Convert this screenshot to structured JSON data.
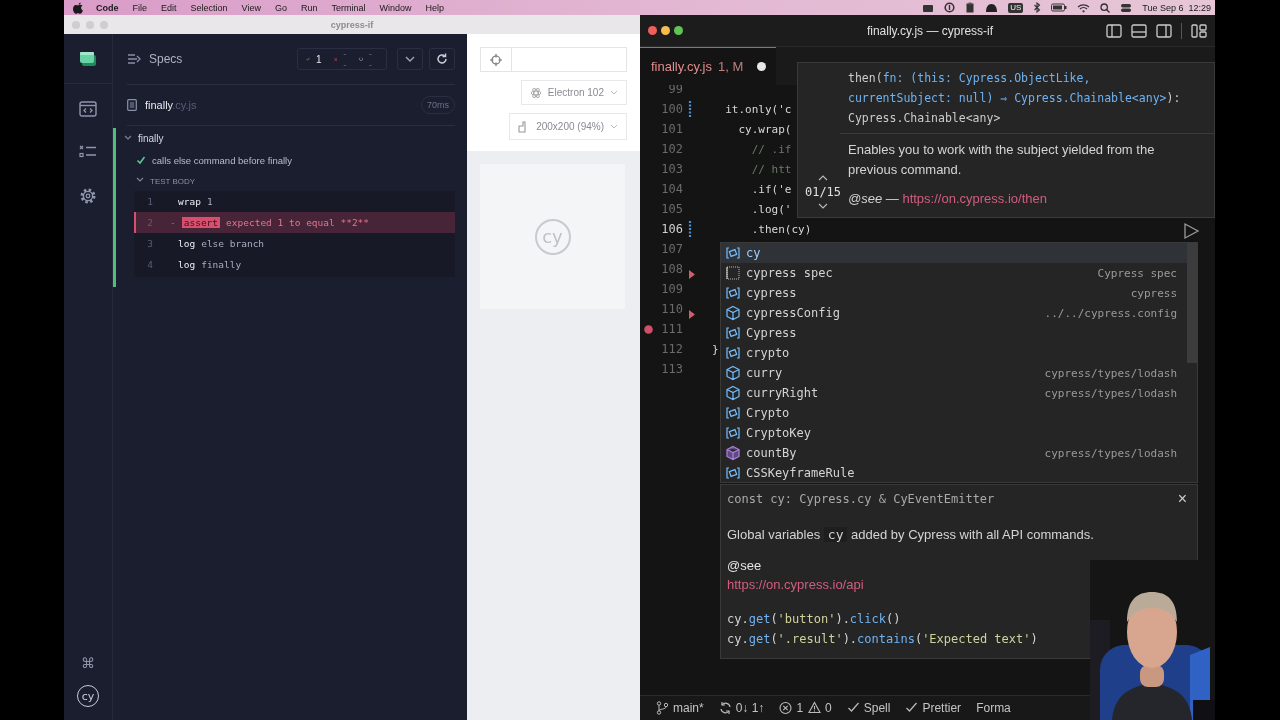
{
  "menu_bar": {
    "app": "Code",
    "items": [
      "File",
      "Edit",
      "Selection",
      "View",
      "Go",
      "Run",
      "Terminal",
      "Window",
      "Help"
    ],
    "input_source": "US",
    "clock": "Tue Sep 6  12:29"
  },
  "cypress_window": {
    "title": "cypress-if",
    "shortcut_icon": "⌘",
    "logo": "cy",
    "reporter": {
      "title": "Specs",
      "passed": "1",
      "failed": "--",
      "pending": "--",
      "spec": {
        "name": "finally",
        "extension": ".cy.js",
        "duration": "70ms"
      },
      "suite": {
        "title": "finally",
        "expanded": true,
        "test": {
          "title": "calls else command before finally",
          "passed": true,
          "section": "TEST BODY",
          "section_expanded": true,
          "commands": [
            {
              "number": "1",
              "name": "wrap",
              "message": "1",
              "failed": false
            },
            {
              "number": "2",
              "prefix": "-",
              "name": "assert",
              "message": "expected 1 to equal **2**",
              "failed": true
            },
            {
              "number": "3",
              "name": "log",
              "message": "else branch",
              "failed": false
            },
            {
              "number": "4",
              "name": "log",
              "message": "finally",
              "failed": false
            }
          ]
        }
      }
    },
    "preview": {
      "browser": "Electron 102",
      "viewport": "200x200 (94%)",
      "logo": "cy"
    }
  },
  "editor_window": {
    "title": "finally.cy.js — cypress-if",
    "tabs": [
      {
        "label": "finally.cy.js",
        "badge": "1, M",
        "modified": true,
        "selected": true
      }
    ],
    "lines": [
      {
        "number": "99",
        "current": false
      },
      {
        "number": "100",
        "text": "  it.only('c",
        "kind": "code",
        "current": false,
        "git_change": true
      },
      {
        "number": "101",
        "text": "    cy.wrap(",
        "kind": "code",
        "current": false
      },
      {
        "number": "102",
        "text": "      // .if",
        "kind": "comment",
        "current": false
      },
      {
        "number": "103",
        "text": "      // htt",
        "kind": "comment",
        "current": false
      },
      {
        "number": "104",
        "text": "      .if('e",
        "kind": "code",
        "current": false
      },
      {
        "number": "105",
        "text": "      .log('",
        "kind": "code",
        "current": false
      },
      {
        "number": "106",
        "text": "      .then(cy)",
        "kind": "code",
        "current": true,
        "git_change": true
      },
      {
        "number": "107",
        "current": false
      },
      {
        "number": "108",
        "current": false,
        "folded": true
      },
      {
        "number": "109",
        "current": false
      },
      {
        "number": "110",
        "current": false,
        "folded": true
      },
      {
        "number": "111",
        "current": false,
        "breakpoint": true
      },
      {
        "number": "112",
        "text": "}",
        "kind": "code",
        "current": false
      },
      {
        "number": "113",
        "current": false
      }
    ],
    "signature_help": {
      "counter": "01/15",
      "signature": [
        {
          "text": "then(",
          "kind": "plain"
        },
        {
          "text": "fn: (this: Cypress.ObjectLike, currentSubject: null) ⇒ Cypress.Chainable<any>",
          "kind": "param"
        },
        {
          "text": "):",
          "kind": "plain"
        }
      ],
      "return_type": "Cypress.Chainable<any>",
      "description": "Enables you to work with the subject yielded from the previous command.",
      "see": "@see",
      "see_separator": "—",
      "link": "https://on.cypress.io/then"
    },
    "suggestions": [
      {
        "label": "cy",
        "kind": "variable",
        "selected": true
      },
      {
        "label": "cypress spec",
        "kind": "snippet",
        "detail": "Cypress spec",
        "selected": false
      },
      {
        "label": "cypress",
        "kind": "variable",
        "detail": "cypress",
        "selected": false
      },
      {
        "label": "cypressConfig",
        "kind": "module",
        "detail": "../../cypress.config",
        "selected": false
      },
      {
        "label": "Cypress",
        "kind": "variable",
        "selected": false
      },
      {
        "label": "crypto",
        "kind": "variable",
        "selected": false
      },
      {
        "label": "curry",
        "kind": "module",
        "detail": "cypress/types/lodash",
        "selected": false
      },
      {
        "label": "curryRight",
        "kind": "module",
        "detail": "cypress/types/lodash",
        "selected": false
      },
      {
        "label": "Crypto",
        "kind": "variable",
        "selected": false
      },
      {
        "label": "CryptoKey",
        "kind": "variable",
        "selected": false
      },
      {
        "label": "countBy",
        "kind": "method",
        "detail": "cypress/types/lodash",
        "selected": false
      },
      {
        "label": "CSSKeyframeRule",
        "kind": "variable",
        "selected": false
      }
    ],
    "details": {
      "signature": "const cy: Cypress.cy & CyEventEmitter",
      "close": "×",
      "description": [
        {
          "text": "Global variables ",
          "kind": "plain"
        },
        {
          "text": "cy",
          "kind": "code"
        },
        {
          "text": " added by Cypress with all API commands.",
          "kind": "plain"
        }
      ],
      "see": "@see",
      "link": "https://on.cypress.io/api",
      "examples": [
        [
          {
            "text": "cy",
            "kind": "ident"
          },
          {
            "text": ".",
            "kind": "punct"
          },
          {
            "text": "get",
            "kind": "method"
          },
          {
            "text": "(",
            "kind": "punct"
          },
          {
            "text": "'button'",
            "kind": "string"
          },
          {
            "text": ").",
            "kind": "punct"
          },
          {
            "text": "click",
            "kind": "method"
          },
          {
            "text": "()",
            "kind": "punct"
          }
        ],
        [
          {
            "text": "cy",
            "kind": "ident"
          },
          {
            "text": ".",
            "kind": "punct"
          },
          {
            "text": "get",
            "kind": "method"
          },
          {
            "text": "(",
            "kind": "punct"
          },
          {
            "text": "'.result'",
            "kind": "string"
          },
          {
            "text": ").",
            "kind": "punct"
          },
          {
            "text": "contains",
            "kind": "method"
          },
          {
            "text": "(",
            "kind": "punct"
          },
          {
            "text": "'Expected text'",
            "kind": "string"
          },
          {
            "text": ")",
            "kind": "punct"
          }
        ]
      ]
    },
    "status_bar": [
      {
        "kind": "branch",
        "text": "main*"
      },
      {
        "kind": "sync",
        "text": "0↓ 1↑"
      },
      {
        "kind": "errors",
        "text": "1"
      },
      {
        "kind": "warnings",
        "text": "0"
      },
      {
        "kind": "check",
        "text": "Spell"
      },
      {
        "kind": "check",
        "text": "Prettier"
      },
      {
        "kind": "plain",
        "text": "Forma"
      }
    ]
  }
}
